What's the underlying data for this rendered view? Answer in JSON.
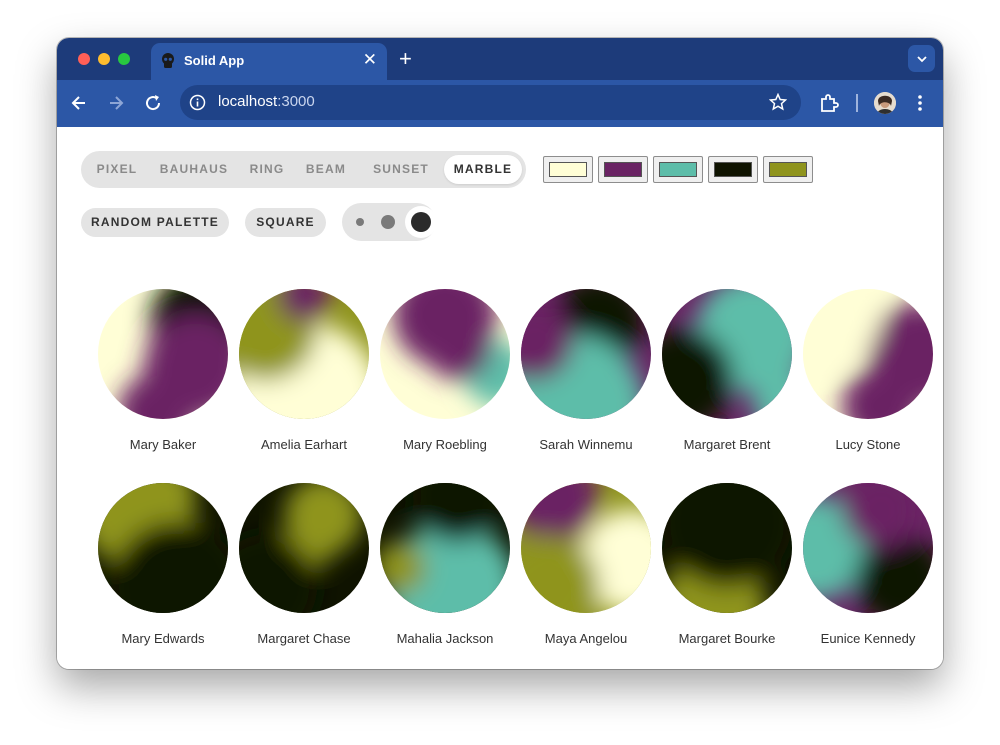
{
  "browser": {
    "tab_title": "Solid App",
    "close_glyph": "✕",
    "new_tab_glyph": "+",
    "tab_menu_glyph": "⌄",
    "url_host": "localhost",
    "url_port": ":3000",
    "back_glyph": "←",
    "forward_glyph": "→",
    "reload_glyph": "↻"
  },
  "variants": {
    "items": [
      "PIXEL",
      "BAUHAUS",
      "RING",
      "BEAM",
      "SUNSET",
      "MARBLE"
    ],
    "selected": "MARBLE"
  },
  "palette": {
    "colors": [
      "#fffed6",
      "#6a2364",
      "#5dbda9",
      "#0f1300",
      "#8f941d"
    ]
  },
  "controls": {
    "random_palette_label": "RANDOM PALETTE",
    "shape_label": "SQUARE",
    "selected_size": "large"
  },
  "avatars": [
    {
      "name": "Mary Baker",
      "base": 0,
      "blobs": [
        [
          3,
          0.8,
          0.25,
          0.4
        ],
        [
          1,
          0.75,
          0.6,
          0.4
        ],
        [
          1,
          0.45,
          0.95,
          0.3
        ]
      ]
    },
    {
      "name": "Amelia Earhart",
      "base": 4,
      "blobs": [
        [
          0,
          0.5,
          0.85,
          0.6
        ],
        [
          4,
          0.2,
          0.3,
          0.4
        ],
        [
          1,
          0.5,
          0.05,
          0.2
        ]
      ]
    },
    {
      "name": "Mary Roebling",
      "base": 0,
      "blobs": [
        [
          1,
          0.5,
          0.2,
          0.4
        ],
        [
          2,
          0.9,
          0.65,
          0.25
        ],
        [
          1,
          0.6,
          0.45,
          0.25
        ]
      ]
    },
    {
      "name": "Sarah Winnemu",
      "base": 1,
      "blobs": [
        [
          3,
          0.6,
          0.25,
          0.35
        ],
        [
          2,
          0.4,
          0.9,
          0.55
        ],
        [
          1,
          0.1,
          0.4,
          0.3
        ]
      ]
    },
    {
      "name": "Margaret Brent",
      "base": 1,
      "blobs": [
        [
          2,
          0.7,
          0.35,
          0.45
        ],
        [
          3,
          0.15,
          0.7,
          0.4
        ],
        [
          2,
          0.95,
          0.9,
          0.25
        ]
      ]
    },
    {
      "name": "Lucy Stone",
      "base": 0,
      "blobs": [
        [
          1,
          0.9,
          0.5,
          0.4
        ],
        [
          1,
          0.6,
          0.9,
          0.3
        ],
        [
          0,
          0.2,
          0.2,
          0.4
        ]
      ]
    },
    {
      "name": "Mary Edwards",
      "base": 3,
      "blobs": [
        [
          4,
          0.3,
          0.2,
          0.45
        ],
        [
          4,
          0.55,
          0.05,
          0.2
        ],
        [
          3,
          0.6,
          0.8,
          0.5
        ]
      ]
    },
    {
      "name": "Margaret Chase",
      "base": 3,
      "blobs": [
        [
          4,
          0.65,
          0.25,
          0.3
        ],
        [
          4,
          0.55,
          0.45,
          0.2
        ],
        [
          3,
          0.2,
          0.8,
          0.4
        ]
      ]
    },
    {
      "name": "Mahalia Jackson",
      "base": 3,
      "blobs": [
        [
          2,
          0.55,
          0.8,
          0.5
        ],
        [
          4,
          0.15,
          0.65,
          0.2
        ],
        [
          3,
          0.6,
          0.1,
          0.35
        ]
      ]
    },
    {
      "name": "Maya Angelou",
      "base": 4,
      "blobs": [
        [
          0,
          0.85,
          0.6,
          0.4
        ],
        [
          1,
          0.25,
          0.1,
          0.35
        ],
        [
          4,
          0.2,
          0.8,
          0.4
        ]
      ]
    },
    {
      "name": "Margaret Bourke",
      "base": 3,
      "blobs": [
        [
          4,
          0.45,
          0.95,
          0.35
        ],
        [
          4,
          0.2,
          0.85,
          0.2
        ],
        [
          3,
          0.5,
          0.3,
          0.5
        ]
      ]
    },
    {
      "name": "Eunice Kennedy",
      "base": 1,
      "blobs": [
        [
          2,
          0.1,
          0.5,
          0.4
        ],
        [
          3,
          0.75,
          0.75,
          0.35
        ],
        [
          1,
          0.6,
          0.2,
          0.3
        ]
      ]
    }
  ]
}
